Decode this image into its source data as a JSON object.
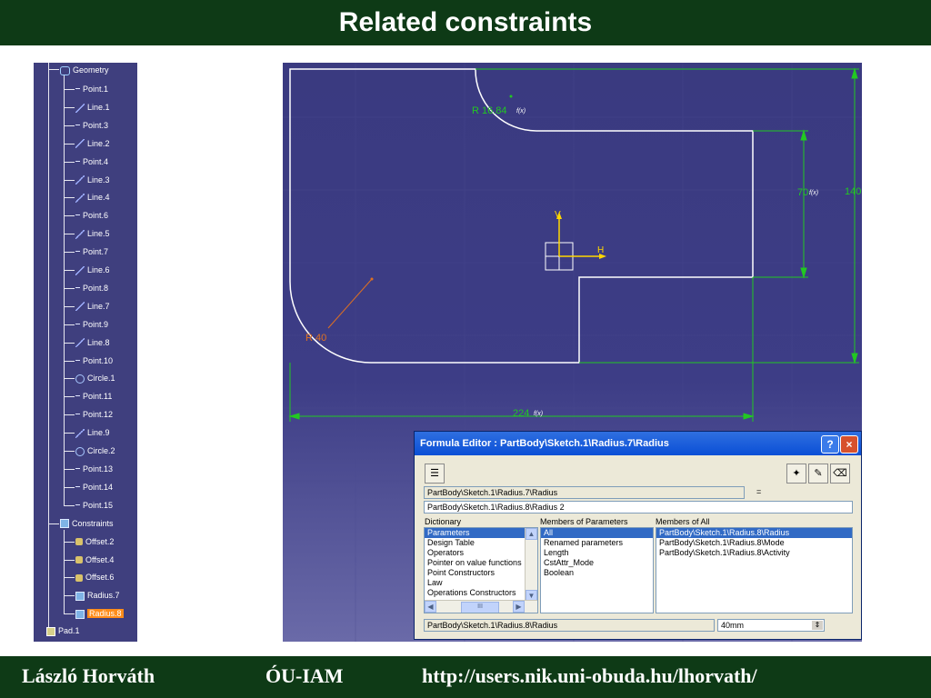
{
  "slide": {
    "title": "Related constraints",
    "footer": {
      "author": "László Horváth",
      "institute": "ÓU-IAM",
      "url": "http://users.nik.uni-obuda.hu/lhorvath/"
    }
  },
  "tree": {
    "geometry_label": "Geometry",
    "geometry_items": [
      {
        "label": "Point.1",
        "icon": "point-icon"
      },
      {
        "label": "Line.1",
        "icon": "line-icon"
      },
      {
        "label": "Point.3",
        "icon": "point-icon"
      },
      {
        "label": "Line.2",
        "icon": "line-icon"
      },
      {
        "label": "Point.4",
        "icon": "point-icon"
      },
      {
        "label": "Line.3",
        "icon": "line-icon"
      },
      {
        "label": "Line.4",
        "icon": "line-icon"
      },
      {
        "label": "Point.6",
        "icon": "point-icon"
      },
      {
        "label": "Line.5",
        "icon": "line-icon"
      },
      {
        "label": "Point.7",
        "icon": "point-icon"
      },
      {
        "label": "Line.6",
        "icon": "line-icon"
      },
      {
        "label": "Point.8",
        "icon": "point-icon"
      },
      {
        "label": "Line.7",
        "icon": "line-icon"
      },
      {
        "label": "Point.9",
        "icon": "point-icon"
      },
      {
        "label": "Line.8",
        "icon": "line-icon"
      },
      {
        "label": "Point.10",
        "icon": "point-icon"
      },
      {
        "label": "Circle.1",
        "icon": "circle-icon"
      },
      {
        "label": "Point.11",
        "icon": "point-icon"
      },
      {
        "label": "Point.12",
        "icon": "point-icon"
      },
      {
        "label": "Line.9",
        "icon": "line-icon"
      },
      {
        "label": "Circle.2",
        "icon": "circle-icon"
      },
      {
        "label": "Point.13",
        "icon": "point-icon"
      },
      {
        "label": "Point.14",
        "icon": "point-icon"
      },
      {
        "label": "Point.15",
        "icon": "point-icon"
      }
    ],
    "constraints_label": "Constraints",
    "constraint_items": [
      {
        "label": "Offset.2",
        "icon": "offset-icon"
      },
      {
        "label": "Offset.4",
        "icon": "offset-icon"
      },
      {
        "label": "Offset.6",
        "icon": "offset-icon"
      },
      {
        "label": "Radius.7",
        "icon": "radius-icon"
      },
      {
        "label": "Radius.8",
        "icon": "radius-icon",
        "selected": true
      }
    ],
    "pad_label": "Pad.1"
  },
  "viewport": {
    "dims": {
      "r_top": "R 16.84",
      "r_bottom": "R 40",
      "height_inner": "70",
      "height_outer": "140",
      "width": "224",
      "fx_marker": "f(x)"
    },
    "axis_v": "V",
    "axis_h": "H",
    "colors": {
      "profile": "#ffffff",
      "dimension": "#22c822",
      "radius_dim": "#e07020",
      "axis": "#ffd700"
    }
  },
  "dialog": {
    "title": "Formula Editor : PartBody\\Sketch.1\\Radius.7\\Radius",
    "help_label": "?",
    "close_label": "×",
    "param_field": "PartBody\\Sketch.1\\Radius.7\\Radius",
    "equals": "=",
    "formula_field": "PartBody\\Sketch.1\\Radius.8\\Radius 2",
    "dictionary_label": "Dictionary",
    "dictionary_items": [
      "Parameters",
      "Design Table",
      "Operators",
      "Pointer on value functions",
      "Point Constructors",
      "Law",
      "Operations Constructors"
    ],
    "members_params_label": "Members of Parameters",
    "members_params_items": [
      "All",
      "Renamed parameters",
      "Length",
      "CstAttr_Mode",
      "Boolean"
    ],
    "members_all_label": "Members of All",
    "members_all_items": [
      "PartBody\\Sketch.1\\Radius.8\\Radius",
      "PartBody\\Sketch.1\\Radius.8\\Mode",
      "PartBody\\Sketch.1\\Radius.8\\Activity"
    ],
    "status_field": "PartBody\\Sketch.1\\Radius.8\\Radius",
    "value_field": "40mm",
    "scroll_mid": "III"
  }
}
